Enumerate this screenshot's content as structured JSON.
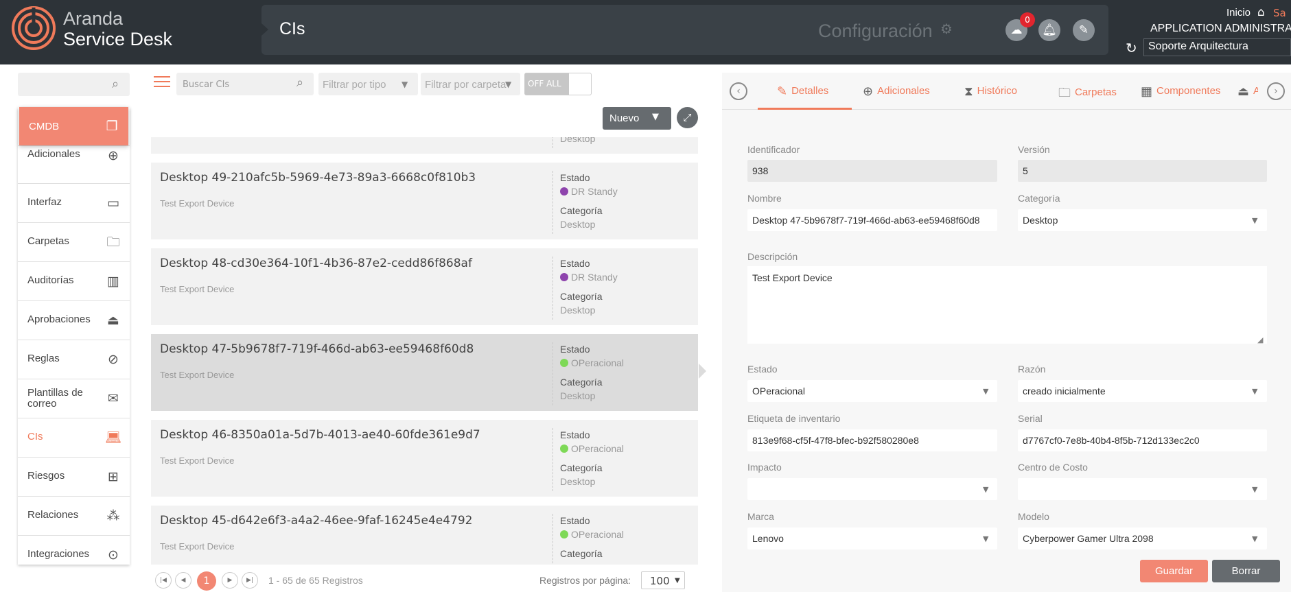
{
  "header": {
    "brand_line1": "Aranda",
    "brand_line2": "Service Desk",
    "title": "CIs",
    "config_label": "Configuración",
    "notifications_badge": "0",
    "inicio_label": "Inicio",
    "salir_label": "Sa",
    "user_role": "APPLICATION ADMINISTRAT",
    "project": "Soporte Arquitectura"
  },
  "sidebar": {
    "items": [
      {
        "label": "CMDB",
        "icon": "stack-icon"
      },
      {
        "label": "Adicionales",
        "icon": "plus-circle-icon"
      },
      {
        "label": "Interfaz",
        "icon": "monitor-icon"
      },
      {
        "label": "Carpetas",
        "icon": "folder-icon"
      },
      {
        "label": "Auditorías",
        "icon": "clipboard-chart-icon"
      },
      {
        "label": "Aprobaciones",
        "icon": "stamp-icon"
      },
      {
        "label": "Reglas",
        "icon": "compass-icon"
      },
      {
        "label": "Plantillas de correo",
        "icon": "envelope-icon"
      },
      {
        "label": "CIs",
        "icon": "laptop-icon"
      },
      {
        "label": "Riesgos",
        "icon": "barrier-icon"
      },
      {
        "label": "Relaciones",
        "icon": "network-icon"
      },
      {
        "label": "Integraciones",
        "icon": "integration-icon"
      }
    ]
  },
  "toolbar": {
    "search_placeholder": "Buscar CIs",
    "filter_type": "Filtrar por tipo",
    "filter_folder": "Filtrar por carpeta",
    "toggle_label": "OFF  ALL",
    "new_button": "Nuevo"
  },
  "ci_list": [
    {
      "name": "",
      "desc": "",
      "estado_label": "",
      "estado": "",
      "estado_color": "#8e44ad",
      "categoria_label": "",
      "categoria": "Desktop"
    },
    {
      "name": "Desktop 49-210afc5b-5969-4e73-89a3-6668c0f810b3",
      "desc": "Test Export Device",
      "estado_label": "Estado",
      "estado": "DR Standy",
      "estado_color": "#8e44ad",
      "categoria_label": "Categoría",
      "categoria": "Desktop"
    },
    {
      "name": "Desktop 48-cd30e364-10f1-4b36-87e2-cedd86f868af",
      "desc": "Test Export Device",
      "estado_label": "Estado",
      "estado": "DR Standy",
      "estado_color": "#8e44ad",
      "categoria_label": "Categoría",
      "categoria": "Desktop"
    },
    {
      "name": "Desktop 47-5b9678f7-719f-466d-ab63-ee59468f60d8",
      "desc": "Test Export Device",
      "estado_label": "Estado",
      "estado": "OPeracional",
      "estado_color": "#7ed957",
      "categoria_label": "Categoría",
      "categoria": "Desktop"
    },
    {
      "name": "Desktop 46-8350a01a-5d7b-4013-ae40-60fde361e9d7",
      "desc": "Test Export Device",
      "estado_label": "Estado",
      "estado": "OPeracional",
      "estado_color": "#7ed957",
      "categoria_label": "Categoría",
      "categoria": "Desktop"
    },
    {
      "name": "Desktop 45-d642e6f3-a4a2-46ee-9faf-16245e4e4792",
      "desc": "Test Export Device",
      "estado_label": "Estado",
      "estado": "OPeracional",
      "estado_color": "#7ed957",
      "categoria_label": "Categoría",
      "categoria": "Desktop"
    }
  ],
  "pagination": {
    "current_page": "1",
    "info": "1 - 65 de 65 Registros",
    "per_page_label": "Registros por página:",
    "per_page": "100"
  },
  "detail": {
    "tabs": [
      {
        "label": "Detalles",
        "icon": "edit-icon"
      },
      {
        "label": "Adicionales",
        "icon": "plus-circle-icon"
      },
      {
        "label": "Histórico",
        "icon": "hourglass-icon"
      },
      {
        "label": "Carpetas",
        "icon": "folder-icon"
      },
      {
        "label": "Componentes",
        "icon": "components-icon"
      },
      {
        "label": "A",
        "icon": "stamp-icon"
      }
    ],
    "fields": {
      "identificador_label": "Identificador",
      "identificador": "938",
      "version_label": "Versión",
      "version": "5",
      "nombre_label": "Nombre",
      "nombre": "Desktop 47-5b9678f7-719f-466d-ab63-ee59468f60d8",
      "categoria_label": "Categoría",
      "categoria": "Desktop",
      "descripcion_label": "Descripción",
      "descripcion": "Test Export Device",
      "estado_label": "Estado",
      "estado": "OPeracional",
      "razon_label": "Razón",
      "razon": "creado inicialmente",
      "etiqueta_label": "Etiqueta de inventario",
      "etiqueta": "813e9f68-cf5f-47f8-bfec-b92f580280e8",
      "serial_label": "Serial",
      "serial": "d7767cf0-7e8b-40b4-8f5b-712d133ec2c0",
      "impacto_label": "Impacto",
      "impacto": "",
      "centro_label": "Centro de Costo",
      "centro": "",
      "marca_label": "Marca",
      "marca": "Lenovo",
      "modelo_label": "Modelo",
      "modelo": "Cyberpower Gamer Ultra 2098"
    },
    "save_button": "Guardar",
    "delete_button": "Borrar"
  },
  "colors": {
    "accent": "#f07a5a",
    "header_bg": "#2d3338",
    "status_standby": "#8e44ad",
    "status_operational": "#7ed957"
  }
}
